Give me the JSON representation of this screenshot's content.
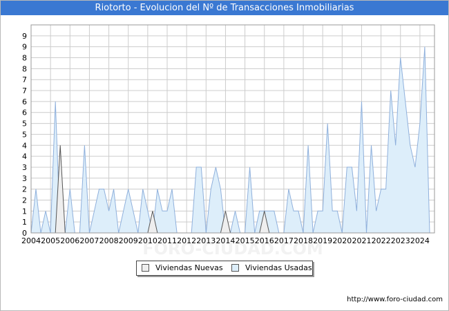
{
  "title": "Riotorto - Evolucion del Nº de Transacciones Inmobiliarias",
  "source": "http://www.foro-ciudad.com",
  "watermark": "FORO-CIUDAD.COM",
  "colors": {
    "title_bg": "#3a78d2",
    "usadas_fill": "#ddeefa",
    "usadas_line": "#8fb0dc",
    "nuevas_fill": "#eeeeee",
    "nuevas_line": "#555555",
    "grid": "#cccccc"
  },
  "legend": {
    "nuevas": "Viviendas Nuevas",
    "usadas": "Viviendas Usadas"
  },
  "chart_data": {
    "type": "area",
    "x_tick_labels": [
      "2004",
      "2005",
      "2006",
      "2007",
      "2008",
      "2009",
      "2010",
      "2011",
      "2012",
      "2013",
      "2014",
      "2015",
      "2016",
      "2017",
      "2018",
      "2019",
      "2020",
      "2021",
      "2022",
      "2023",
      "2024"
    ],
    "y_tick_labels": [
      "0",
      "1",
      "1",
      "2",
      "2",
      "3",
      "3",
      "4",
      "4",
      "5",
      "5",
      "6",
      "6",
      "7",
      "7",
      "8",
      "8",
      "9",
      "9"
    ],
    "ylim": [
      0,
      9.5
    ],
    "x_range": [
      2004,
      2024.75
    ],
    "grid": true,
    "legend_position": "bottom-center",
    "series": [
      {
        "name": "Viviendas Nuevas",
        "x": [
          2004,
          2004.25,
          2004.5,
          2004.75,
          2005,
          2005.25,
          2005.5,
          2005.75,
          2006,
          2009,
          2009.75,
          2010,
          2010.25,
          2010.5,
          2010.75,
          2013.5,
          2013.75,
          2014,
          2014.25,
          2015.5,
          2015.75,
          2016,
          2016.25,
          2024.75
        ],
        "values": [
          0,
          0,
          0,
          0,
          0,
          0,
          4,
          0,
          0,
          0,
          0,
          0,
          1,
          0,
          0,
          0,
          0,
          1,
          0,
          0,
          0,
          1,
          0,
          0
        ]
      },
      {
        "name": "Viviendas Usadas",
        "x": [
          2004,
          2004.25,
          2004.5,
          2004.75,
          2005,
          2005.25,
          2005.5,
          2005.75,
          2006,
          2006.25,
          2006.5,
          2006.75,
          2007,
          2007.25,
          2007.5,
          2007.75,
          2008,
          2008.25,
          2008.5,
          2008.75,
          2009,
          2009.25,
          2009.5,
          2009.75,
          2010,
          2010.25,
          2010.5,
          2010.75,
          2011,
          2011.25,
          2011.5,
          2011.75,
          2012,
          2012.25,
          2012.5,
          2012.75,
          2013,
          2013.25,
          2013.5,
          2013.75,
          2014,
          2014.25,
          2014.5,
          2014.75,
          2015,
          2015.25,
          2015.5,
          2015.75,
          2016,
          2016.25,
          2016.5,
          2016.75,
          2017,
          2017.25,
          2017.5,
          2017.75,
          2018,
          2018.25,
          2018.5,
          2018.75,
          2019,
          2019.25,
          2019.5,
          2019.75,
          2020,
          2020.25,
          2020.5,
          2020.75,
          2021,
          2021.25,
          2021.5,
          2021.75,
          2022,
          2022.25,
          2022.5,
          2022.75,
          2023,
          2023.25,
          2023.5,
          2023.75,
          2024,
          2024.25,
          2024.5,
          2024.75
        ],
        "values": [
          0,
          2,
          0,
          1,
          0,
          6,
          0,
          0,
          2,
          0,
          0,
          4,
          0,
          1,
          2,
          2,
          1,
          2,
          0,
          1,
          2,
          1,
          0,
          2,
          1,
          0,
          2,
          1,
          1,
          2,
          0,
          0,
          0,
          0,
          3,
          3,
          0,
          2,
          3,
          2,
          0,
          0,
          1,
          0,
          0,
          3,
          0,
          1,
          1,
          1,
          1,
          0,
          0,
          2,
          1,
          1,
          0,
          4,
          0,
          1,
          1,
          5,
          1,
          1,
          0,
          3,
          3,
          1,
          6,
          0,
          4,
          1,
          2,
          2,
          6.5,
          4,
          8,
          6,
          4,
          3,
          5,
          8.5,
          0,
          0
        ]
      }
    ]
  }
}
